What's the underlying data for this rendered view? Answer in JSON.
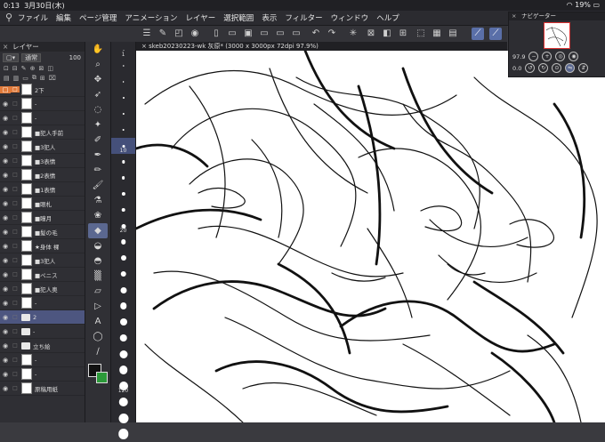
{
  "status": {
    "time": "0:13",
    "date": "3月30日(木)",
    "battery": "19%",
    "wifi_icon": "wifi-icon",
    "battery_icon": "battery-icon"
  },
  "menu": [
    "ファイル",
    "編集",
    "ページ管理",
    "アニメーション",
    "レイヤー",
    "選択範囲",
    "表示",
    "フィルター",
    "ウィンドウ",
    "ヘルプ"
  ],
  "layer_panel": {
    "title": "レイヤー",
    "blend_mode": "通常",
    "opacity": "100",
    "layers": [
      {
        "name": "2下",
        "type": "layer",
        "state": "orange"
      },
      {
        "name": "-",
        "type": "layer"
      },
      {
        "name": "-",
        "type": "layer"
      },
      {
        "name": "■犯人手前",
        "type": "layer"
      },
      {
        "name": "■3犯人",
        "type": "layer"
      },
      {
        "name": "■3表情",
        "type": "layer"
      },
      {
        "name": "■2表情",
        "type": "layer"
      },
      {
        "name": "■1表情",
        "type": "layer"
      },
      {
        "name": "■眼札",
        "type": "layer"
      },
      {
        "name": "■瞳月",
        "type": "layer"
      },
      {
        "name": "■髪の毛",
        "type": "layer"
      },
      {
        "name": "★身体 裸",
        "type": "layer"
      },
      {
        "name": "■3犯人",
        "type": "layer"
      },
      {
        "name": "■ペニス",
        "type": "layer"
      },
      {
        "name": "■犯人奥",
        "type": "layer"
      },
      {
        "name": "-",
        "type": "layer"
      },
      {
        "name": "2",
        "type": "folder",
        "state": "selected"
      },
      {
        "name": "-",
        "type": "folder"
      },
      {
        "name": "立ち絵",
        "type": "folder"
      },
      {
        "name": "-",
        "type": "layer"
      },
      {
        "name": "-",
        "type": "layer"
      },
      {
        "name": "原稿用紙",
        "type": "layer"
      }
    ]
  },
  "brush_sizes": [
    "1",
    "",
    "",
    "",
    "",
    "",
    "10",
    "",
    "",
    "",
    "",
    "20",
    "",
    "",
    "",
    "",
    "",
    "",
    "",
    "",
    "",
    "120",
    "",
    "",
    ""
  ],
  "document_tab": "skeb20230223-wk 灰原* (3000 x 3000px 72dpi 97.9%)",
  "navigator": {
    "title": "ナビゲーター",
    "zoom": "97.9",
    "rotation": "0.0"
  },
  "colors": {
    "foreground": "#111111",
    "background": "#2c9a3a",
    "selection": "#4d5680",
    "accent": "#e07a3a"
  }
}
